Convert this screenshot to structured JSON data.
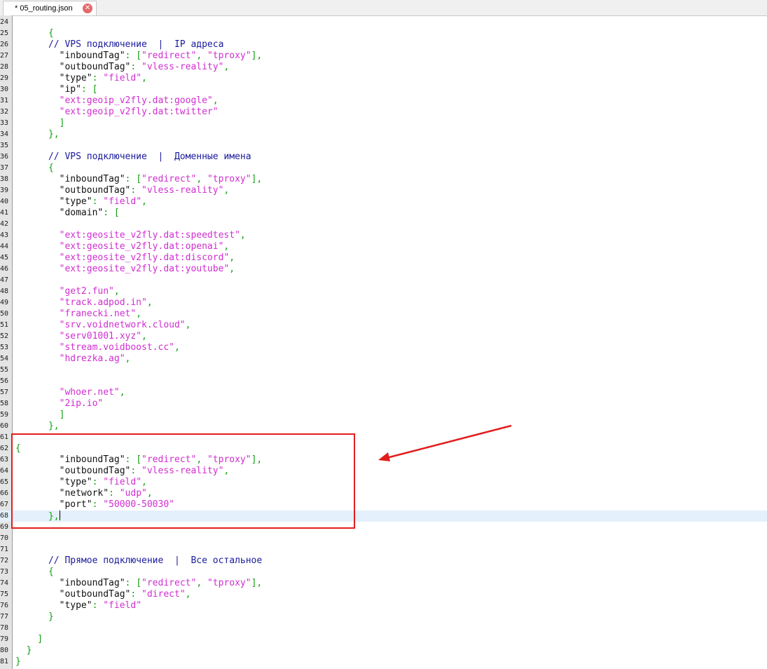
{
  "tab": {
    "title": "* 05_routing.json",
    "close_glyph": "✕"
  },
  "editor": {
    "current_line": 68,
    "lines": [
      {
        "n": "24",
        "t": []
      },
      {
        "n": "25",
        "t": [
          {
            "c": "punct",
            "v": "      {"
          }
        ]
      },
      {
        "n": "26",
        "t": [
          {
            "c": "cmt",
            "v": "      // VPS подключение  |  IP адреса"
          }
        ]
      },
      {
        "n": "27",
        "t": [
          {
            "c": "key",
            "v": "        \"inboundTag\""
          },
          {
            "c": "punct",
            "v": ": ["
          },
          {
            "c": "str",
            "v": "\"redirect\""
          },
          {
            "c": "punct",
            "v": ", "
          },
          {
            "c": "str",
            "v": "\"tproxy\""
          },
          {
            "c": "punct",
            "v": "],"
          }
        ]
      },
      {
        "n": "28",
        "t": [
          {
            "c": "key",
            "v": "        \"outboundTag\""
          },
          {
            "c": "punct",
            "v": ": "
          },
          {
            "c": "str",
            "v": "\"vless-reality\""
          },
          {
            "c": "punct",
            "v": ","
          }
        ]
      },
      {
        "n": "29",
        "t": [
          {
            "c": "key",
            "v": "        \"type\""
          },
          {
            "c": "punct",
            "v": ": "
          },
          {
            "c": "str",
            "v": "\"field\""
          },
          {
            "c": "punct",
            "v": ","
          }
        ]
      },
      {
        "n": "30",
        "t": [
          {
            "c": "key",
            "v": "        \"ip\""
          },
          {
            "c": "punct",
            "v": ": ["
          }
        ]
      },
      {
        "n": "31",
        "t": [
          {
            "c": "str",
            "v": "        \"ext:geoip_v2fly.dat:google\""
          },
          {
            "c": "punct",
            "v": ","
          }
        ]
      },
      {
        "n": "32",
        "t": [
          {
            "c": "str",
            "v": "        \"ext:geoip_v2fly.dat:twitter\""
          }
        ]
      },
      {
        "n": "33",
        "t": [
          {
            "c": "punct",
            "v": "        ]"
          }
        ]
      },
      {
        "n": "34",
        "t": [
          {
            "c": "punct",
            "v": "      },"
          }
        ]
      },
      {
        "n": "35",
        "t": []
      },
      {
        "n": "36",
        "t": [
          {
            "c": "cmt",
            "v": "      // VPS подключение  |  Доменные имена"
          }
        ]
      },
      {
        "n": "37",
        "t": [
          {
            "c": "punct",
            "v": "      {"
          }
        ]
      },
      {
        "n": "38",
        "t": [
          {
            "c": "key",
            "v": "        \"inboundTag\""
          },
          {
            "c": "punct",
            "v": ": ["
          },
          {
            "c": "str",
            "v": "\"redirect\""
          },
          {
            "c": "punct",
            "v": ", "
          },
          {
            "c": "str",
            "v": "\"tproxy\""
          },
          {
            "c": "punct",
            "v": "],"
          }
        ]
      },
      {
        "n": "39",
        "t": [
          {
            "c": "key",
            "v": "        \"outboundTag\""
          },
          {
            "c": "punct",
            "v": ": "
          },
          {
            "c": "str",
            "v": "\"vless-reality\""
          },
          {
            "c": "punct",
            "v": ","
          }
        ]
      },
      {
        "n": "40",
        "t": [
          {
            "c": "key",
            "v": "        \"type\""
          },
          {
            "c": "punct",
            "v": ": "
          },
          {
            "c": "str",
            "v": "\"field\""
          },
          {
            "c": "punct",
            "v": ","
          }
        ]
      },
      {
        "n": "41",
        "t": [
          {
            "c": "key",
            "v": "        \"domain\""
          },
          {
            "c": "punct",
            "v": ": ["
          }
        ]
      },
      {
        "n": "42",
        "t": []
      },
      {
        "n": "43",
        "t": [
          {
            "c": "str",
            "v": "        \"ext:geosite_v2fly.dat:speedtest\""
          },
          {
            "c": "punct",
            "v": ","
          }
        ]
      },
      {
        "n": "44",
        "t": [
          {
            "c": "str",
            "v": "        \"ext:geosite_v2fly.dat:openai\""
          },
          {
            "c": "punct",
            "v": ","
          }
        ]
      },
      {
        "n": "45",
        "t": [
          {
            "c": "str",
            "v": "        \"ext:geosite_v2fly.dat:discord\""
          },
          {
            "c": "punct",
            "v": ","
          }
        ]
      },
      {
        "n": "46",
        "t": [
          {
            "c": "str",
            "v": "        \"ext:geosite_v2fly.dat:youtube\""
          },
          {
            "c": "punct",
            "v": ","
          }
        ]
      },
      {
        "n": "47",
        "t": []
      },
      {
        "n": "48",
        "t": [
          {
            "c": "str",
            "v": "        \"get2.fun\""
          },
          {
            "c": "punct",
            "v": ","
          }
        ]
      },
      {
        "n": "49",
        "t": [
          {
            "c": "str",
            "v": "        \"track.adpod.in\""
          },
          {
            "c": "punct",
            "v": ","
          }
        ]
      },
      {
        "n": "50",
        "t": [
          {
            "c": "str",
            "v": "        \"franecki.net\""
          },
          {
            "c": "punct",
            "v": ","
          }
        ]
      },
      {
        "n": "51",
        "t": [
          {
            "c": "str",
            "v": "        \"srv.voidnetwork.cloud\""
          },
          {
            "c": "punct",
            "v": ","
          }
        ]
      },
      {
        "n": "52",
        "t": [
          {
            "c": "str",
            "v": "        \"serv01001.xyz\""
          },
          {
            "c": "punct",
            "v": ","
          }
        ]
      },
      {
        "n": "53",
        "t": [
          {
            "c": "str",
            "v": "        \"stream.voidboost.cc\""
          },
          {
            "c": "punct",
            "v": ","
          }
        ]
      },
      {
        "n": "54",
        "t": [
          {
            "c": "str",
            "v": "        \"hdrezka.ag\""
          },
          {
            "c": "punct",
            "v": ","
          }
        ]
      },
      {
        "n": "55",
        "t": []
      },
      {
        "n": "56",
        "t": []
      },
      {
        "n": "57",
        "t": [
          {
            "c": "str",
            "v": "        \"whoer.net\""
          },
          {
            "c": "punct",
            "v": ","
          }
        ]
      },
      {
        "n": "58",
        "t": [
          {
            "c": "str",
            "v": "        \"2ip.io\""
          }
        ]
      },
      {
        "n": "59",
        "t": [
          {
            "c": "punct",
            "v": "        ]"
          }
        ]
      },
      {
        "n": "60",
        "t": [
          {
            "c": "punct",
            "v": "      },"
          }
        ]
      },
      {
        "n": "61",
        "t": []
      },
      {
        "n": "62",
        "t": [
          {
            "c": "punct",
            "v": "{"
          }
        ]
      },
      {
        "n": "63",
        "t": [
          {
            "c": "key",
            "v": "        \"inboundTag\""
          },
          {
            "c": "punct",
            "v": ": ["
          },
          {
            "c": "str",
            "v": "\"redirect\""
          },
          {
            "c": "punct",
            "v": ", "
          },
          {
            "c": "str",
            "v": "\"tproxy\""
          },
          {
            "c": "punct",
            "v": "],"
          }
        ]
      },
      {
        "n": "64",
        "t": [
          {
            "c": "key",
            "v": "        \"outboundTag\""
          },
          {
            "c": "punct",
            "v": ": "
          },
          {
            "c": "str",
            "v": "\"vless-reality\""
          },
          {
            "c": "punct",
            "v": ","
          }
        ]
      },
      {
        "n": "65",
        "t": [
          {
            "c": "key",
            "v": "        \"type\""
          },
          {
            "c": "punct",
            "v": ": "
          },
          {
            "c": "str",
            "v": "\"field\""
          },
          {
            "c": "punct",
            "v": ","
          }
        ]
      },
      {
        "n": "66",
        "t": [
          {
            "c": "key",
            "v": "        \"network\""
          },
          {
            "c": "punct",
            "v": ": "
          },
          {
            "c": "str",
            "v": "\"udp\""
          },
          {
            "c": "punct",
            "v": ","
          }
        ]
      },
      {
        "n": "67",
        "t": [
          {
            "c": "key",
            "v": "        \"port\""
          },
          {
            "c": "punct",
            "v": ": "
          },
          {
            "c": "str",
            "v": "\"50000-50030\""
          }
        ]
      },
      {
        "n": "68",
        "t": [
          {
            "c": "punct",
            "v": "      },"
          }
        ]
      },
      {
        "n": "69",
        "t": []
      },
      {
        "n": "70",
        "t": []
      },
      {
        "n": "71",
        "t": []
      },
      {
        "n": "72",
        "t": [
          {
            "c": "cmt",
            "v": "      // Прямое подключение  |  Все остальное"
          }
        ]
      },
      {
        "n": "73",
        "t": [
          {
            "c": "punct",
            "v": "      {"
          }
        ]
      },
      {
        "n": "74",
        "t": [
          {
            "c": "key",
            "v": "        \"inboundTag\""
          },
          {
            "c": "punct",
            "v": ": ["
          },
          {
            "c": "str",
            "v": "\"redirect\""
          },
          {
            "c": "punct",
            "v": ", "
          },
          {
            "c": "str",
            "v": "\"tproxy\""
          },
          {
            "c": "punct",
            "v": "],"
          }
        ]
      },
      {
        "n": "75",
        "t": [
          {
            "c": "key",
            "v": "        \"outboundTag\""
          },
          {
            "c": "punct",
            "v": ": "
          },
          {
            "c": "str",
            "v": "\"direct\""
          },
          {
            "c": "punct",
            "v": ","
          }
        ]
      },
      {
        "n": "76",
        "t": [
          {
            "c": "key",
            "v": "        \"type\""
          },
          {
            "c": "punct",
            "v": ": "
          },
          {
            "c": "str",
            "v": "\"field\""
          }
        ]
      },
      {
        "n": "77",
        "t": [
          {
            "c": "punct",
            "v": "      }"
          }
        ]
      },
      {
        "n": "78",
        "t": []
      },
      {
        "n": "79",
        "t": [
          {
            "c": "punct",
            "v": "    ]"
          }
        ]
      },
      {
        "n": "80",
        "t": [
          {
            "c": "punct",
            "v": "  }"
          }
        ]
      },
      {
        "n": "81",
        "t": [
          {
            "c": "punct",
            "v": "}"
          }
        ]
      }
    ]
  },
  "colors": {
    "highlight_box": "#e21e1e",
    "string": "#d02ed0",
    "comment": "#1a1a9c",
    "punctuation": "#10a010"
  }
}
